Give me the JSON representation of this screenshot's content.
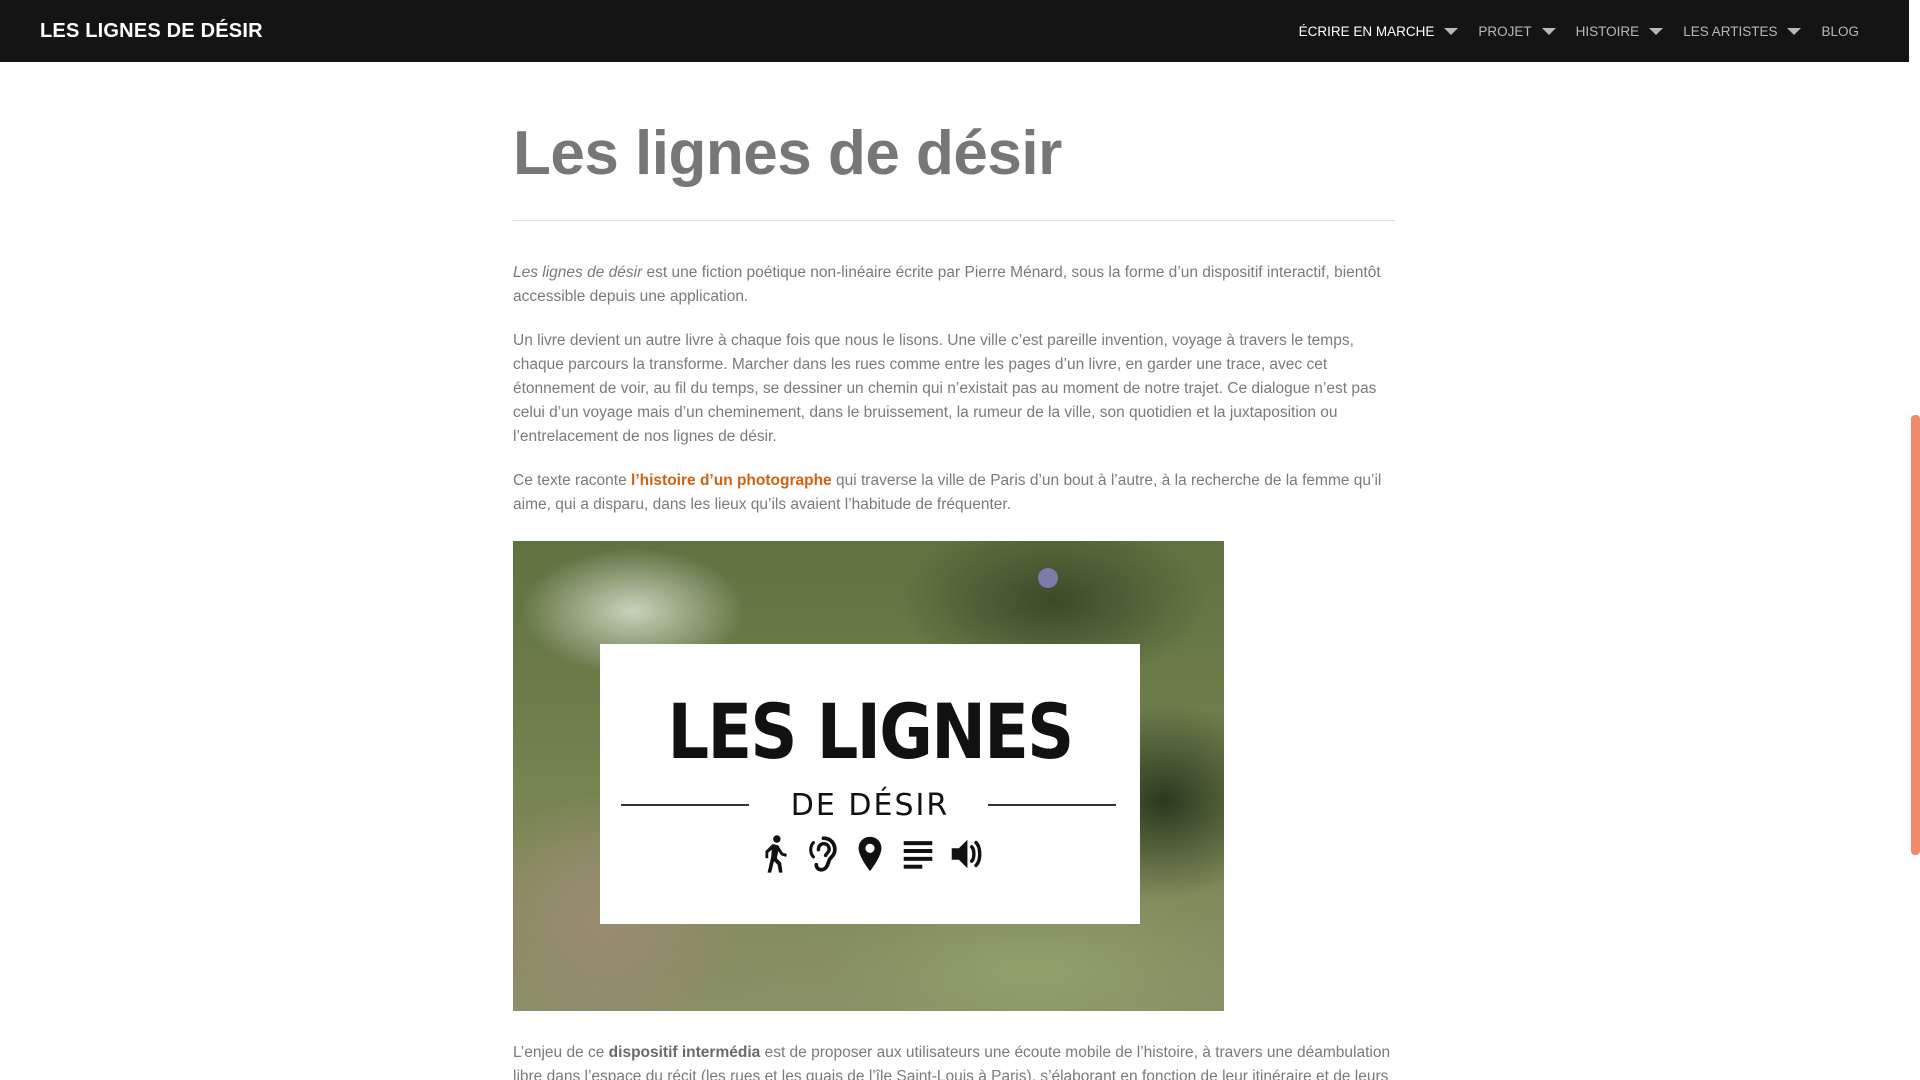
{
  "site": {
    "brand": "LES LIGNES DE DÉSIR"
  },
  "nav": {
    "items": [
      {
        "label": "ÉCRIRE EN MARCHE",
        "has_dropdown": true,
        "active": true
      },
      {
        "label": "PROJET",
        "has_dropdown": true,
        "active": false
      },
      {
        "label": "HISTOIRE",
        "has_dropdown": true,
        "active": false
      },
      {
        "label": "LES ARTISTES",
        "has_dropdown": true,
        "active": false
      },
      {
        "label": "BLOG",
        "has_dropdown": false,
        "active": false
      }
    ]
  },
  "page": {
    "title": "Les lignes de désir",
    "p1": {
      "em": "Les lignes de désir",
      "rest": " est une fiction poétique non-linéaire écrite par Pierre Ménard, sous la forme d’un dispositif interactif, bientôt accessible depuis une application."
    },
    "p2": "Un livre devient un autre livre à chaque fois que nous le lisons. Une ville c’est pareille invention, voyage à travers le temps, chaque parcours la transforme. Marcher dans les rues comme entre les pages d’un livre, en garder une trace, avec cet étonnement de voir, au fil du temps, se dessiner un chemin qui n’existait pas au moment de notre trajet. Ce dialogue n’est pas celui d’un voyage mais d’un cheminement, dans le bruissement, la rumeur de la ville, son quotidien et la juxtaposition ou l’entrelacement de nos lignes de désir.",
    "p3": {
      "before": "Ce texte raconte ",
      "link": "l’histoire d’un photographe",
      "after": " qui traverse la ville de Paris d’un bout à l’autre, à la recherche de la femme qu’il aime, qui a disparu, dans les lieux qu’ils avaient l’habitude de fréquenter."
    },
    "p4": {
      "before": "L’enjeu de ce ",
      "bold": "dispositif intermédia",
      "after": " est de proposer aux utilisateurs une écoute mobile de l’histoire, à travers une déambulation libre dans l’espace du récit (les rues et les quais de l’île Saint-Louis à Paris), s’élaborant en fonction de leur itinéraire et de leurs"
    }
  },
  "hero": {
    "logo_title": "LES LIGNES",
    "logo_subtitle": "DE DÉSIR",
    "icons": [
      "walking-person-icon",
      "ear-icon",
      "map-pin-icon",
      "text-lines-icon",
      "speaker-icon"
    ]
  },
  "colors": {
    "navbar": "#141414",
    "link": "#d46012",
    "text": "#7a7a7a",
    "scrollbar": "#ef8a6e"
  }
}
